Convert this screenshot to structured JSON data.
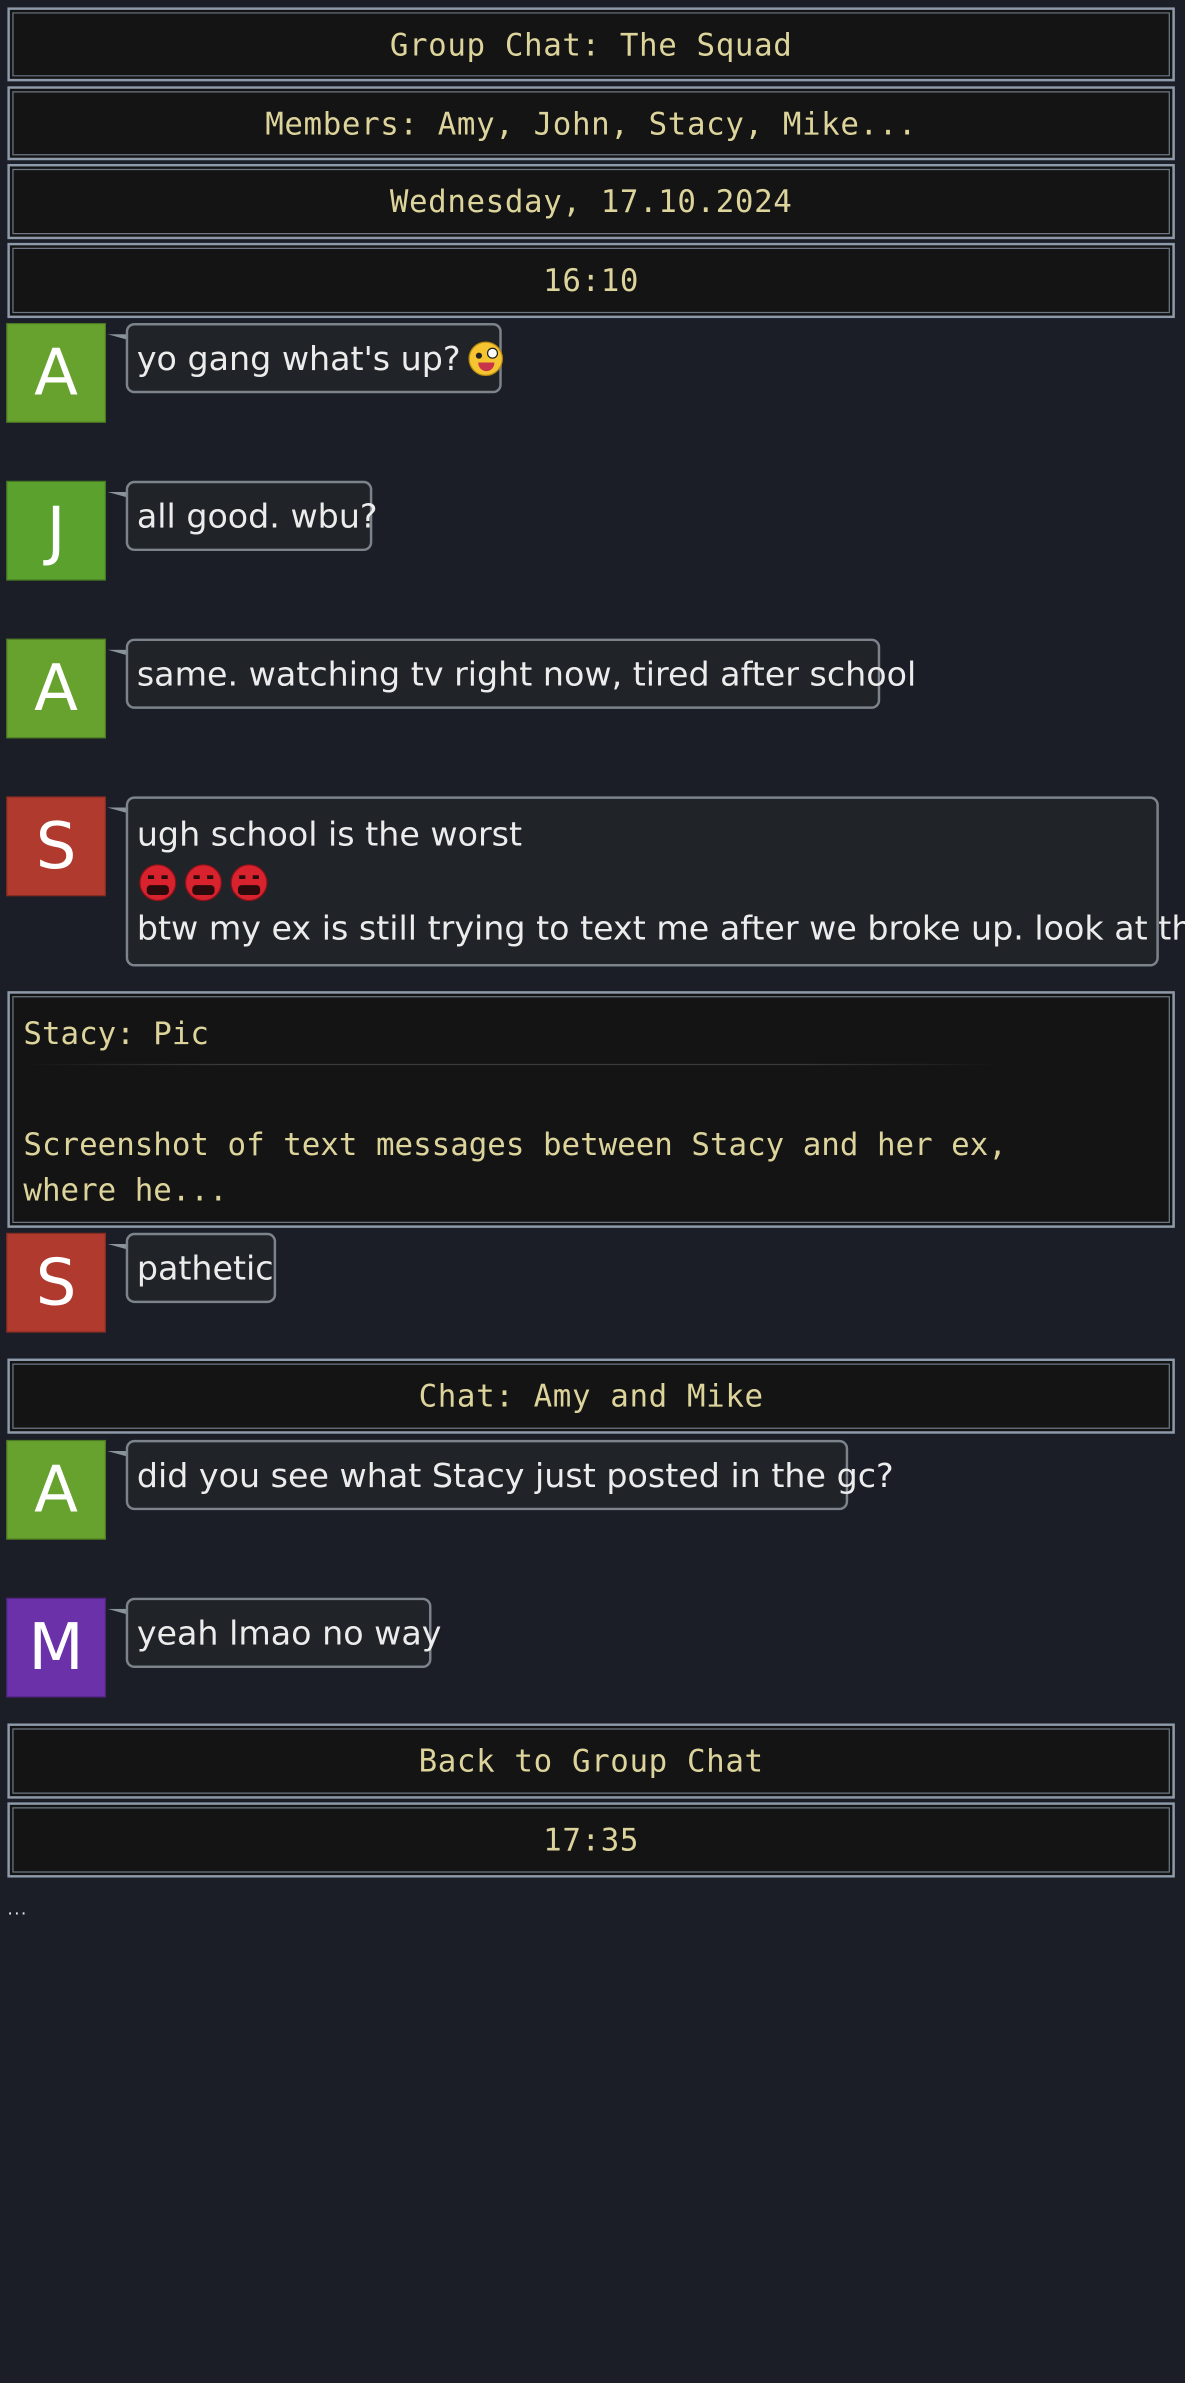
{
  "header": {
    "title": "Group Chat: The Squad",
    "members": "Members: Amy, John, Stacy, Mike...",
    "date": "Wednesday, 17.10.2024",
    "time": "16:10"
  },
  "colors": {
    "amy": "#67a22e",
    "john": "#5ba12e",
    "stacy": "#b03a2e",
    "mike": "#6b31a8",
    "banner_text": "#ddd49c",
    "background": "#1b1e27"
  },
  "messages": [
    {
      "sender_initial": "A",
      "text": "yo gang what's up?",
      "emoji": "zany-face"
    },
    {
      "sender_initial": "J",
      "text": "all good. wbu?"
    },
    {
      "sender_initial": "A",
      "text": "same. watching tv right now, tired after school"
    },
    {
      "sender_initial": "S",
      "line1": "ugh school is the worst",
      "emojis": [
        "cursing-face",
        "cursing-face",
        "cursing-face"
      ],
      "line2": "btw my ex is still trying to text me after we broke up. look at this"
    }
  ],
  "pic_card": {
    "title": "Stacy: Pic",
    "description_line1": "Screenshot of text messages between Stacy and her ex,",
    "description_line2": "where he..."
  },
  "message_after_pic": {
    "sender_initial": "S",
    "text": "pathetic"
  },
  "side_chat": {
    "title": "Chat: Amy and Mike",
    "messages": [
      {
        "sender_initial": "A",
        "text": "did you see what Stacy just posted in the gc?"
      },
      {
        "sender_initial": "M",
        "text": "yeah lmao no way"
      }
    ]
  },
  "back_banner": "Back to Group Chat",
  "time_2": "17:35",
  "continuation": "..."
}
